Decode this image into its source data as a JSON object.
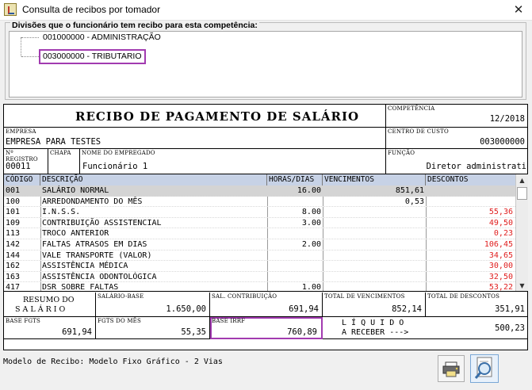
{
  "window": {
    "title": "Consulta de recibos por tomador",
    "close_glyph": "✕"
  },
  "divisions": {
    "legend": "Divisões que o funcionário tem recibo para esta competência:",
    "items": [
      "001000000 - ADMINISTRAÇÃO",
      "003000000 - TRIBUTARIO"
    ]
  },
  "receipt": {
    "title": "RECIBO DE PAGAMENTO DE SALÁRIO",
    "competencia": {
      "label": "COMPETÊNCIA",
      "value": "12/2018"
    },
    "empresa": {
      "label": "EMPRESA",
      "value": "EMPRESA PARA TESTES"
    },
    "centro_custo": {
      "label": "CENTRO DE CUSTO",
      "value": "003000000"
    },
    "registro": {
      "label": "Nº REGISTRO",
      "value": "00011"
    },
    "chapa": {
      "label": "CHAPA",
      "value": ""
    },
    "empregado": {
      "label": "NOME DO EMPREGADO",
      "value": "Funcionário 1"
    },
    "funcao": {
      "label": "FUNÇÃO",
      "value": "Diretor administrati"
    },
    "table": {
      "headers": [
        "CÓDIGO",
        "DESCRIÇÃO",
        "HORAS/DIAS",
        "VENCIMENTOS",
        "DESCONTOS"
      ],
      "rows": [
        {
          "cod": "001",
          "desc": "SALÁRIO NORMAL",
          "hrs": "16.00",
          "venc": "851,61",
          "descontos": ""
        },
        {
          "cod": "100",
          "desc": "ARREDONDAMENTO DO MÊS",
          "hrs": "",
          "venc": "0,53",
          "descontos": ""
        },
        {
          "cod": "101",
          "desc": "I.N.S.S.",
          "hrs": "8.00",
          "venc": "",
          "descontos": "55,36"
        },
        {
          "cod": "109",
          "desc": "CONTRIBUIÇÃO ASSISTENCIAL",
          "hrs": "3.00",
          "venc": "",
          "descontos": "49,50"
        },
        {
          "cod": "113",
          "desc": "TROCO ANTERIOR",
          "hrs": "",
          "venc": "",
          "descontos": "0,23"
        },
        {
          "cod": "142",
          "desc": "FALTAS ATRASOS EM DIAS",
          "hrs": "2.00",
          "venc": "",
          "descontos": "106,45"
        },
        {
          "cod": "144",
          "desc": "VALE TRANSPORTE (VALOR)",
          "hrs": "",
          "venc": "",
          "descontos": "34,65"
        },
        {
          "cod": "162",
          "desc": "ASSISTÊNCIA MÉDICA",
          "hrs": "",
          "venc": "",
          "descontos": "30,00"
        },
        {
          "cod": "163",
          "desc": "ASSISTÊNCIA ODONTOLÓGICA",
          "hrs": "",
          "venc": "",
          "descontos": "32,50"
        },
        {
          "cod": "417",
          "desc": "DSR SOBRE FALTAS",
          "hrs": "1.00",
          "venc": "",
          "descontos": "53,22"
        }
      ]
    },
    "resumo": {
      "line1": "RESUMO DO",
      "line2": "S A L Á R I O"
    },
    "salario_base": {
      "label": "SALÁRIO-BASE",
      "value": "1.650,00"
    },
    "sal_contribuicao": {
      "label": "SAL. CONTRIBUIÇÃO",
      "value": "691,94"
    },
    "total_vencimentos": {
      "label": "TOTAL DE VENCIMENTOS",
      "value": "852,14"
    },
    "total_descontos": {
      "label": "TOTAL DE DESCONTOS",
      "value": "351,91"
    },
    "base_fgts": {
      "label": "BASE FGTS",
      "value": "691,94"
    },
    "fgts_mes": {
      "label": "FGTS DO MÊS",
      "value": "55,35"
    },
    "base_irrf": {
      "label": "BASE IRRF",
      "value": "760,89"
    },
    "liquido": {
      "line1": "L Í Q U I D O",
      "line2": "A RECEBER --->",
      "value": "500,23"
    }
  },
  "status": "Modelo de Recibo: Modelo Fixo Gráfico - 2 Vias",
  "toolbar": {
    "print_icon": "printer-icon",
    "preview_icon": "magnifier-preview-icon"
  },
  "colors": {
    "header_bg": "#c7d2e6",
    "discount_text": "#e02020",
    "highlight": "#a23bb0"
  }
}
